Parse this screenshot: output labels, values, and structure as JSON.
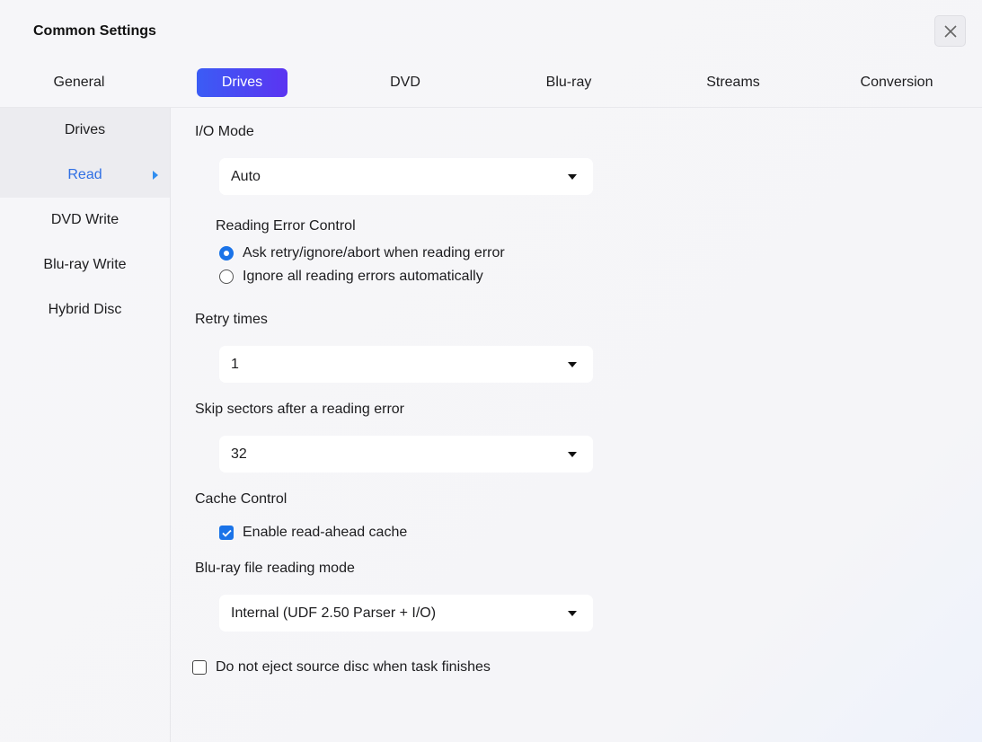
{
  "window": {
    "title": "Common Settings"
  },
  "tabs": [
    {
      "label": "General",
      "active": false
    },
    {
      "label": "Drives",
      "active": true
    },
    {
      "label": "DVD",
      "active": false
    },
    {
      "label": "Blu-ray",
      "active": false
    },
    {
      "label": "Streams",
      "active": false
    },
    {
      "label": "Conversion",
      "active": false
    }
  ],
  "sidebar": {
    "items": [
      {
        "label": "Drives",
        "active": false
      },
      {
        "label": "Read",
        "active": true
      },
      {
        "label": "DVD Write",
        "active": false
      },
      {
        "label": "Blu-ray Write",
        "active": false
      },
      {
        "label": "Hybrid Disc",
        "active": false
      }
    ]
  },
  "read": {
    "io_mode": {
      "label": "I/O Mode",
      "value": "Auto"
    },
    "reading_error_control": {
      "label": "Reading Error Control",
      "options": [
        {
          "label": "Ask retry/ignore/abort when reading error",
          "selected": true
        },
        {
          "label": "Ignore all reading errors automatically",
          "selected": false
        }
      ]
    },
    "retry_times": {
      "label": "Retry times",
      "value": "1"
    },
    "skip_sectors": {
      "label": "Skip sectors after a reading error",
      "value": "32"
    },
    "cache_control": {
      "label": "Cache Control",
      "read_ahead": {
        "label": "Enable read-ahead cache",
        "checked": true
      }
    },
    "bluray_mode": {
      "label": "Blu-ray file reading mode",
      "value": "Internal (UDF 2.50 Parser + I/O)"
    },
    "no_eject": {
      "label": "Do not eject source disc when task finishes",
      "checked": false
    }
  },
  "colors": {
    "accent": "#1a73e8",
    "tab_active_start": "#3b5cf5",
    "tab_active_end": "#5b34f1",
    "sidebar_active_text": "#2f6fe4"
  },
  "icons": {
    "close": "close-icon",
    "dropdown": "chevron-down-icon",
    "active_arrow": "caret-right-icon",
    "check": "check-icon"
  }
}
